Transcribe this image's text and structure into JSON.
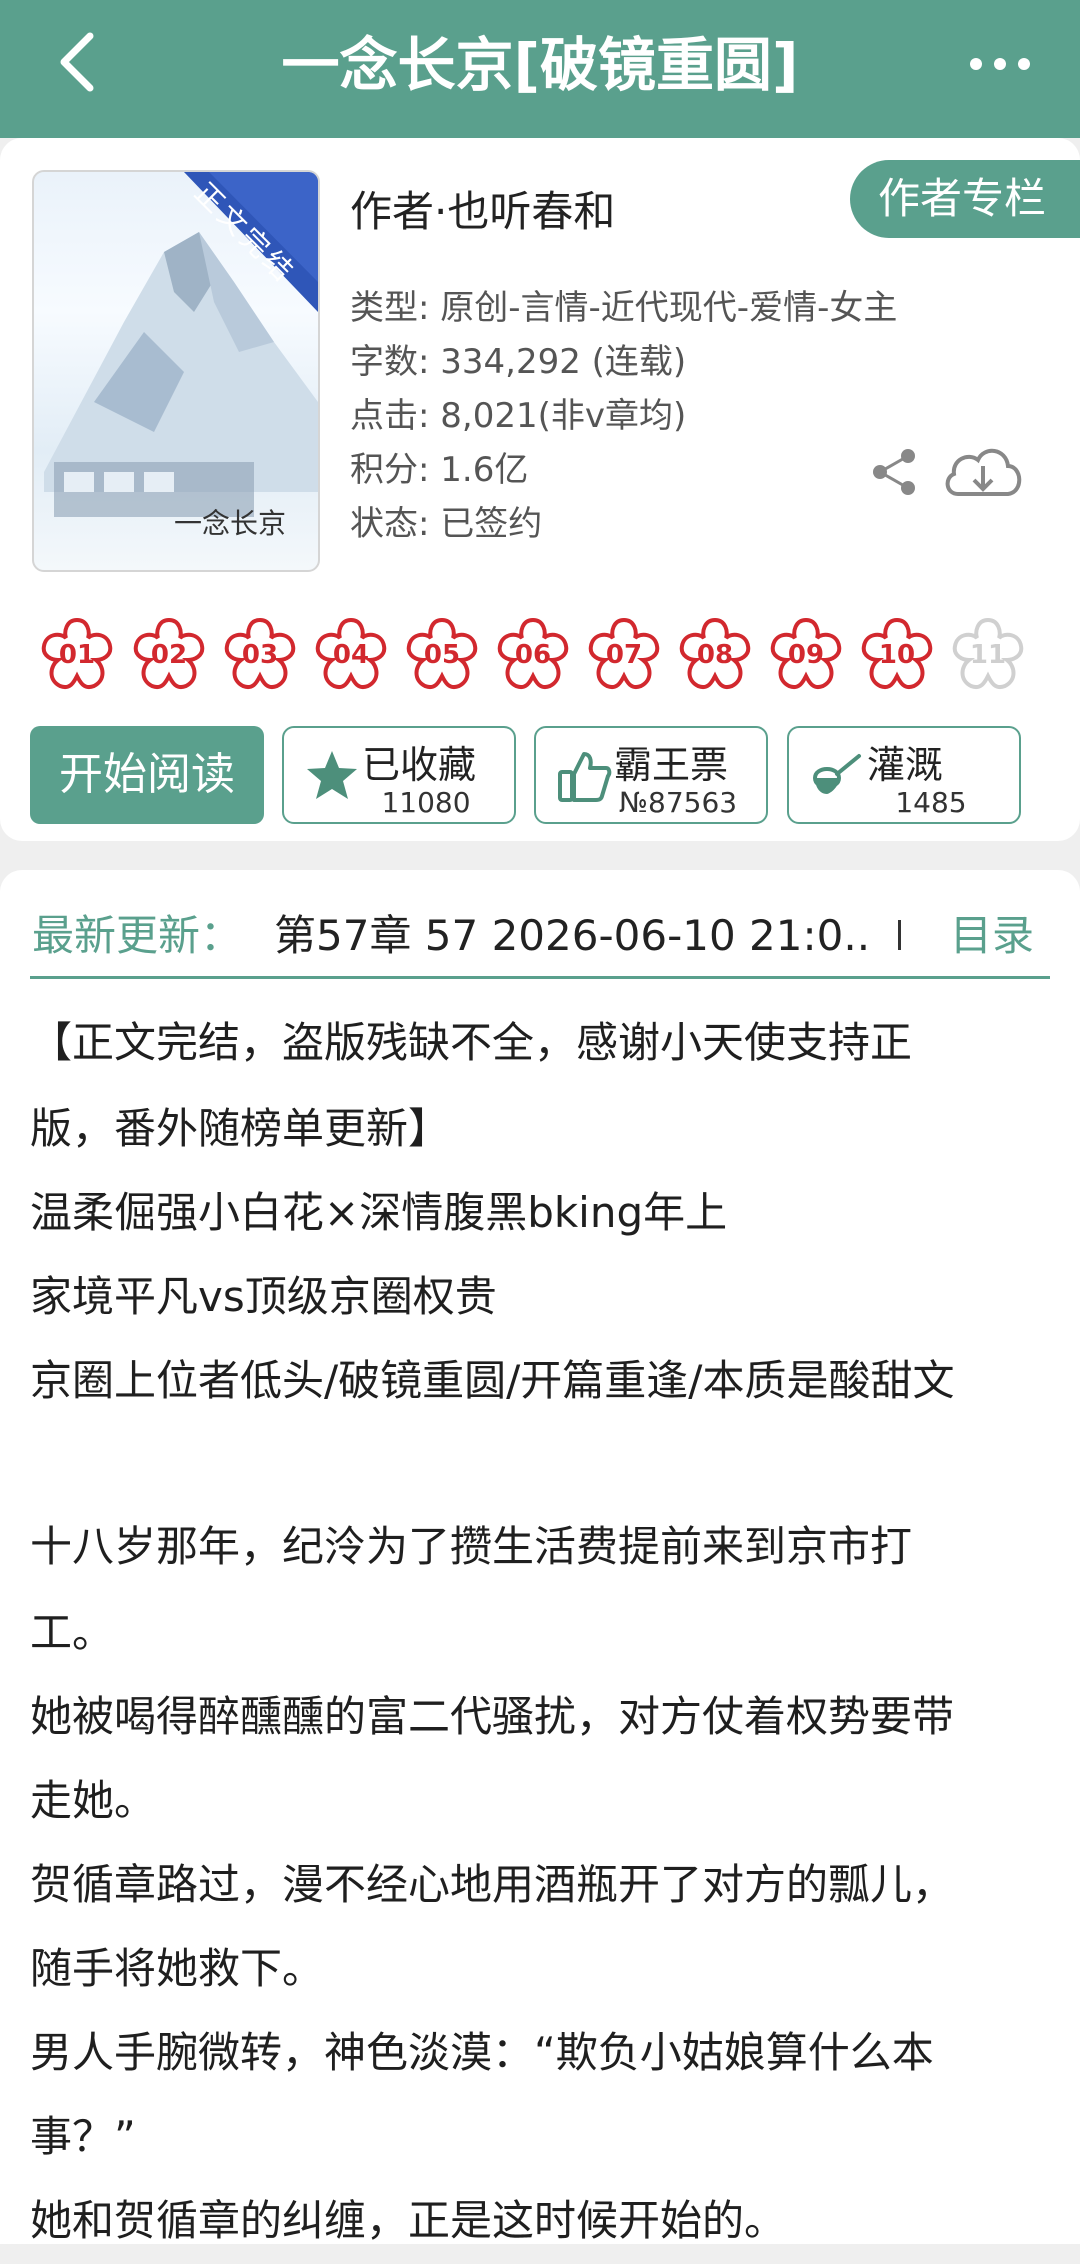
{
  "header": {
    "title": "一念长京[破镜重圆]",
    "back_icon": "chevron-left-icon",
    "more_icon": "more-dots-icon"
  },
  "book": {
    "cover": {
      "ribbon": "正文完结",
      "title": "一念长京"
    },
    "author": "作者·也听春和",
    "author_column_button": "作者专栏",
    "meta": [
      "类型: 原创-言情-近代现代-爱情-女主",
      "字数: 334,292 (连载)",
      "点击: 8,021(非v章均)",
      "积分: 1.6亿",
      "状态: 已签约"
    ]
  },
  "ratings": [
    "01",
    "02",
    "03",
    "04",
    "05",
    "06",
    "07",
    "08",
    "09",
    "10",
    "11"
  ],
  "actions": {
    "read_button": "开始阅读",
    "collect": {
      "label": "已收藏",
      "count": "11080"
    },
    "ticket": {
      "label": "霸王票",
      "count": "№87563"
    },
    "water": {
      "label": "灌溉",
      "count": "1485"
    }
  },
  "latest": {
    "label": "最新更新：",
    "text": "第57章  57  2026-06-10 21:0..",
    "toc": "目录"
  },
  "description": [
    "【正文完结，盗版残缺不全，感谢小天使支持正",
    "版，番外随榜单更新】",
    "温柔倔强小白花×深情腹黑bking年上",
    "家境平凡vs顶级京圈权贵",
    "京圈上位者低头/破镜重圆/开篇重逢/本质是酸甜文",
    "",
    "十八岁那年，纪泠为了攒生活费提前来到京市打",
    "工。",
    "她被喝得醉醺醺的富二代骚扰，对方仗着权势要带",
    "走她。",
    "贺循章路过，漫不经心地用酒瓶开了对方的瓢儿，",
    "随手将她救下。",
    "男人手腕微转，神色淡漠：“欺负小姑娘算什么本",
    "事？”",
    "她和贺循章的纠缠，正是这时候开始的。"
  ],
  "colors": {
    "brand": "#5aa08d",
    "flower": "#d2282e"
  }
}
